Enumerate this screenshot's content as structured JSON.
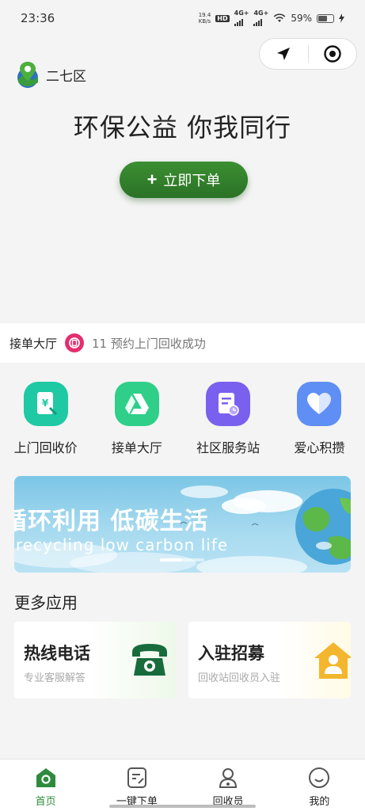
{
  "status_bar": {
    "time": "23:36",
    "net_speed": "19.4",
    "net_unit": "KB/s",
    "hd": "HD",
    "signal_1": "4G+",
    "signal_2": "4G+",
    "battery": "59%"
  },
  "header": {
    "location_name": "二七区",
    "slogan": "环保公益 你我同行",
    "order_button": "立即下单"
  },
  "notice": {
    "title": "接单大厅",
    "message": "11 预约上门回收成功"
  },
  "quick_entries": [
    {
      "label": "上门回收价",
      "icon": "price-tag-icon",
      "color": "#1ec9a4"
    },
    {
      "label": "接单大厅",
      "icon": "order-hall-icon",
      "color": "#2fcf8a"
    },
    {
      "label": "社区服务站",
      "icon": "service-station-icon",
      "color": "#7a60ee"
    },
    {
      "label": "爱心积攒",
      "icon": "heart-icon",
      "color": "#5f8ef5"
    }
  ],
  "banner": {
    "title": "循环利用 低碳生活",
    "subtitle": "recycling low  carbon life"
  },
  "more_apps": {
    "title": "更多应用",
    "cards": [
      {
        "title": "热线电话",
        "subtitle": "专业客服解答",
        "icon": "phone-icon"
      },
      {
        "title": "入驻招募",
        "subtitle": "回收站回收员入驻",
        "icon": "recruit-house-icon"
      }
    ]
  },
  "tabbar": {
    "tabs": [
      {
        "label": "首页",
        "icon": "home-icon",
        "active": true
      },
      {
        "label": "一键下单",
        "icon": "order-icon",
        "active": false
      },
      {
        "label": "回收员",
        "icon": "recycler-icon",
        "active": false
      },
      {
        "label": "我的",
        "icon": "profile-icon",
        "active": false
      }
    ]
  },
  "colors": {
    "brand_green": "#2e8b3c",
    "notice_pink": "#e32e6f",
    "banner_sky": "#7cc6e6"
  }
}
